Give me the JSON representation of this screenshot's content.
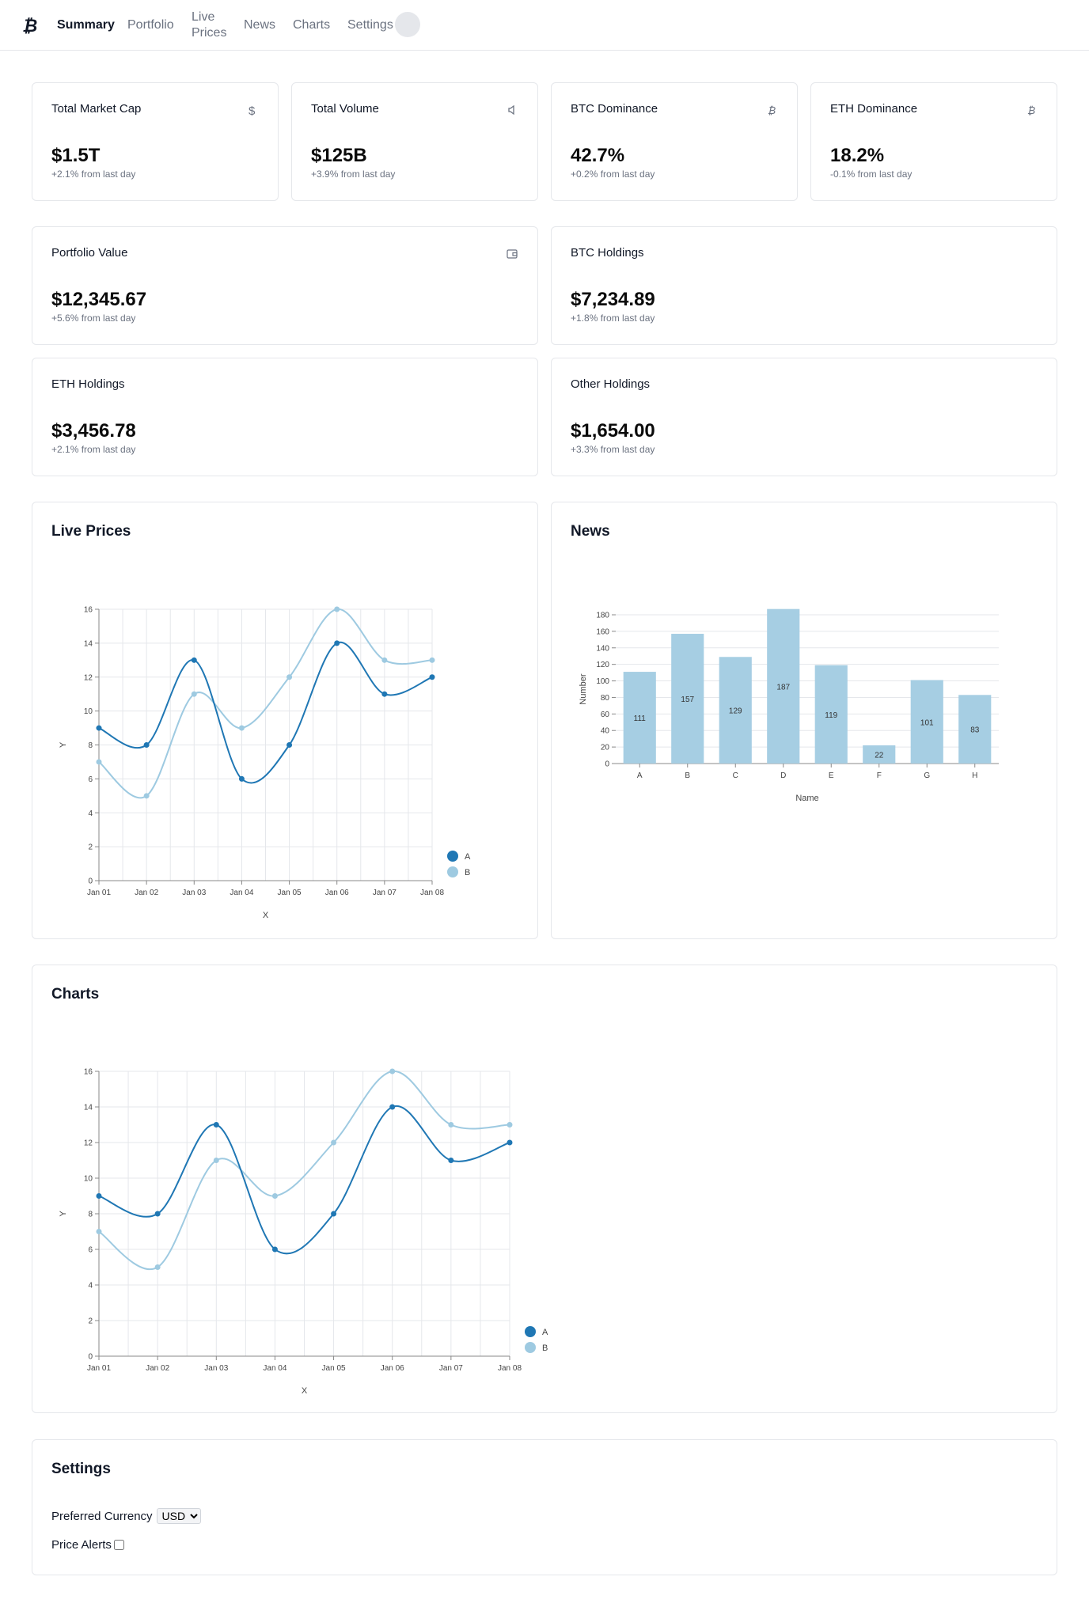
{
  "nav": {
    "items": [
      {
        "label": "Summary",
        "active": true
      },
      {
        "label": "Portfolio"
      },
      {
        "label": "Live Prices"
      },
      {
        "label": "News"
      },
      {
        "label": "Charts"
      },
      {
        "label": "Settings"
      }
    ]
  },
  "stats": [
    {
      "title": "Total Market Cap",
      "value": "$1.5T",
      "change": "+2.1% from last day",
      "icon": "dollar-icon"
    },
    {
      "title": "Total Volume",
      "value": "$125B",
      "change": "+3.9% from last day",
      "icon": "volume-icon"
    },
    {
      "title": "BTC Dominance",
      "value": "42.7%",
      "change": "+0.2% from last day",
      "icon": "bitcoin-icon"
    },
    {
      "title": "ETH Dominance",
      "value": "18.2%",
      "change": "-0.1% from last day",
      "icon": "bitcoin-icon"
    }
  ],
  "portfolio": [
    {
      "title": "Portfolio Value",
      "value": "$12,345.67",
      "change": "+5.6% from last day",
      "icon": "wallet-icon"
    },
    {
      "title": "BTC Holdings",
      "value": "$7,234.89",
      "change": "+1.8% from last day"
    },
    {
      "title": "ETH Holdings",
      "value": "$3,456.78",
      "change": "+2.1% from last day"
    },
    {
      "title": "Other Holdings",
      "value": "$1,654.00",
      "change": "+3.3% from last day"
    }
  ],
  "live_prices": {
    "title": "Live Prices"
  },
  "news": {
    "title": "News"
  },
  "charts": {
    "title": "Charts"
  },
  "settings": {
    "title": "Settings",
    "currency_label": "Preferred Currency",
    "currency_value": "USD",
    "alerts_label": "Price Alerts",
    "alerts_checked": false
  },
  "colors": {
    "series_a": "#1f77b4",
    "series_b": "#9ecae1",
    "bar": "#a6cee3"
  },
  "chart_data": [
    {
      "type": "line",
      "x": [
        "Jan 01",
        "Jan 02",
        "Jan 03",
        "Jan 04",
        "Jan 05",
        "Jan 06",
        "Jan 07",
        "Jan 08"
      ],
      "series": [
        {
          "name": "A",
          "values": [
            9,
            8,
            13,
            6,
            8,
            14,
            11,
            12
          ]
        },
        {
          "name": "B",
          "values": [
            7,
            5,
            11,
            9,
            12,
            16,
            13,
            13
          ]
        }
      ],
      "xlabel": "X",
      "ylabel": "Y",
      "ylim": [
        0,
        16
      ],
      "yticks": [
        0,
        2,
        4,
        6,
        8,
        10,
        12,
        14,
        16
      ],
      "grid": true,
      "legend": "bottom-right"
    },
    {
      "type": "bar",
      "categories": [
        "A",
        "B",
        "C",
        "D",
        "E",
        "F",
        "G",
        "H"
      ],
      "values": [
        111,
        157,
        129,
        187,
        119,
        22,
        101,
        83
      ],
      "xlabel": "Name",
      "ylabel": "Number",
      "ylim": [
        0,
        180
      ],
      "yticks": [
        0,
        20,
        40,
        60,
        80,
        100,
        120,
        140,
        160,
        180
      ],
      "grid": true
    },
    {
      "type": "line",
      "x": [
        "Jan 01",
        "Jan 02",
        "Jan 03",
        "Jan 04",
        "Jan 05",
        "Jan 06",
        "Jan 07",
        "Jan 08"
      ],
      "series": [
        {
          "name": "A",
          "values": [
            9,
            8,
            13,
            6,
            8,
            14,
            11,
            12
          ]
        },
        {
          "name": "B",
          "values": [
            7,
            5,
            11,
            9,
            12,
            16,
            13,
            13
          ]
        }
      ],
      "xlabel": "X",
      "ylabel": "Y",
      "ylim": [
        0,
        16
      ],
      "yticks": [
        0,
        2,
        4,
        6,
        8,
        10,
        12,
        14,
        16
      ],
      "grid": true,
      "legend": "bottom-right"
    }
  ]
}
